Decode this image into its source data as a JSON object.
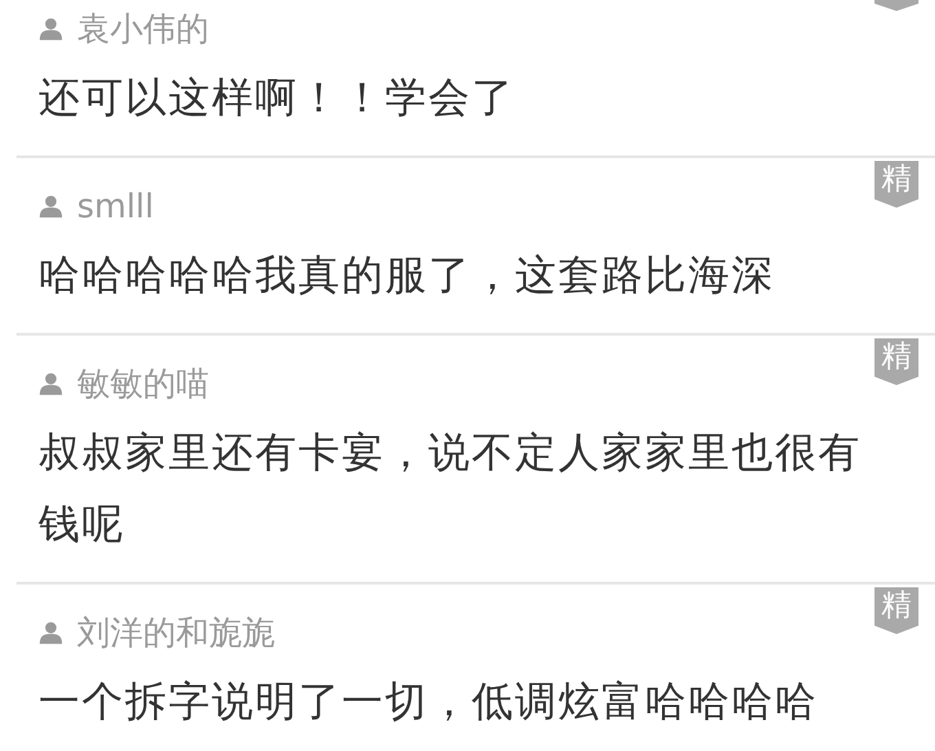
{
  "comments": [
    {
      "user": "袁小伟的",
      "text": "还可以这样啊！！学会了",
      "featured": true,
      "badge_cut": true
    },
    {
      "user": "smlll",
      "text": "哈哈哈哈哈我真的服了，这套路比海深",
      "featured": true,
      "badge": "精"
    },
    {
      "user": "敏敏的喵",
      "text": "叔叔家里还有卡宴，说不定人家家里也很有钱呢",
      "featured": true,
      "badge": "精"
    },
    {
      "user": "刘洋的和旎旎",
      "text": "一个拆字说明了一切，低调炫富哈哈哈哈",
      "featured": true,
      "badge": "精"
    }
  ]
}
